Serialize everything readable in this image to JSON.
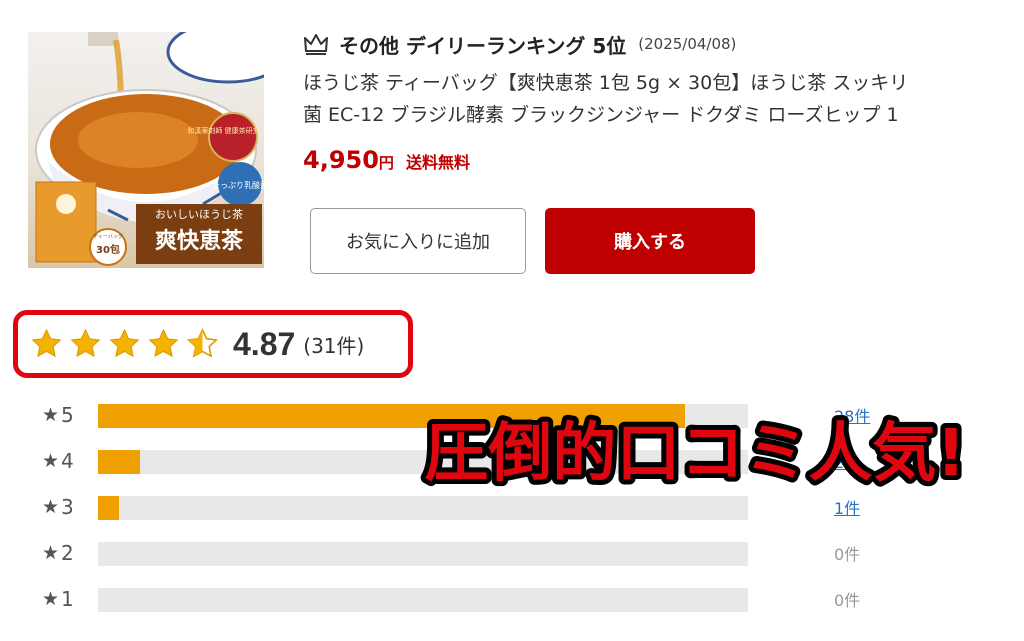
{
  "product": {
    "image_texts": {
      "badge": "和漢薬剤師 健康茶研究 推奨!",
      "lactic": "たっぷり乳酸菌",
      "tagline": "おいしいほうじ茶",
      "brand": "爽快恵茶",
      "bag_label": "ティーバッグ",
      "bag_count": "30包"
    },
    "ranking_text": "その他 デイリーランキング 5位",
    "ranking_date": "(2025/04/08)",
    "title_line1": "ほうじ茶 ティーバッグ【爽快恵茶 1包 5g × 30包】ほうじ茶 スッキリ",
    "title_line2": "菌 EC-12 ブラジル酵素 ブラックジンジャー ドクダミ ローズヒップ 1",
    "price": "4,950",
    "price_unit": "円",
    "shipping": "送料無料",
    "fav_button": "お気に入りに追加",
    "buy_button": "購入する"
  },
  "rating": {
    "score": "4.87",
    "count": "(31件)",
    "stars_value": 4.87,
    "star_color": "#f5b301"
  },
  "distribution": [
    {
      "label": "5",
      "fraction": 0.903,
      "count": "28件",
      "has_reviews": true
    },
    {
      "label": "4",
      "fraction": 0.065,
      "count": "2件",
      "has_reviews": true
    },
    {
      "label": "3",
      "fraction": 0.032,
      "count": "1件",
      "has_reviews": true
    },
    {
      "label": "2",
      "fraction": 0,
      "count": "0件",
      "has_reviews": false
    },
    {
      "label": "1",
      "fraction": 0,
      "count": "0件",
      "has_reviews": false
    }
  ],
  "star_glyph": "★",
  "overlay": {
    "text": "圧倒的口コミ人気!",
    "color": "#e0060f"
  },
  "colors": {
    "accent": "#bf0000",
    "bar": "#f0a000",
    "link": "#2a6fcd"
  }
}
